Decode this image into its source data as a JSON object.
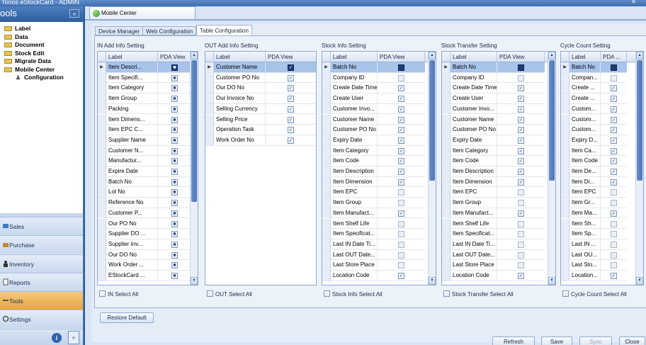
{
  "window": {
    "title": "Tonos eStockCard - ADMIN"
  },
  "leftpane": {
    "header": "ools",
    "tree": [
      {
        "label": "Label"
      },
      {
        "label": "Data"
      },
      {
        "label": "Document"
      },
      {
        "label": "Stock Edit"
      },
      {
        "label": "Migrate Data"
      },
      {
        "label": "Mobile Center"
      }
    ],
    "tree_child": "Configuration",
    "nav": [
      {
        "label": "Sales",
        "icon": "sales-icon"
      },
      {
        "label": "Purchase",
        "icon": "purchase-icon"
      },
      {
        "label": "Inventory",
        "icon": "inventory-icon"
      },
      {
        "label": "Reports",
        "icon": "reports-icon"
      },
      {
        "label": "Tools",
        "icon": "tools-icon",
        "active": true
      },
      {
        "label": "Settings",
        "icon": "settings-icon"
      }
    ],
    "footer_info_icon": "info-icon",
    "footer_more_icon": "chevron-double-down-icon"
  },
  "main": {
    "doc_tab": "Mobile Center",
    "tabs": [
      {
        "label": "Device Manager"
      },
      {
        "label": "Web Configuration"
      },
      {
        "label": "Table Configuration",
        "selected": true
      }
    ],
    "columns": {
      "label": "Label",
      "pda": "PDA View"
    },
    "sections": [
      {
        "title": "IN Add Info Setting",
        "select_all": "IN Select All",
        "rows": [
          {
            "label": "Item Descri...",
            "checked": true
          },
          {
            "label": "Item Specifi...",
            "checked": true
          },
          {
            "label": "Item Category",
            "checked": true
          },
          {
            "label": "Item Group",
            "checked": true
          },
          {
            "label": "Packing",
            "checked": true
          },
          {
            "label": "Item Dimens...",
            "checked": true
          },
          {
            "label": "Item EPC C...",
            "checked": true
          },
          {
            "label": "Supplier Name",
            "checked": true
          },
          {
            "label": "Customer N...",
            "checked": true
          },
          {
            "label": "Manufactur...",
            "checked": true
          },
          {
            "label": "Expire Date",
            "checked": true
          },
          {
            "label": "Batch No",
            "checked": true
          },
          {
            "label": "Lot No",
            "checked": true
          },
          {
            "label": "Reference No",
            "checked": true
          },
          {
            "label": "Customer P...",
            "checked": true
          },
          {
            "label": "Our PO No",
            "checked": true
          },
          {
            "label": "Supplier DO ...",
            "checked": true
          },
          {
            "label": "Supplier Inv...",
            "checked": true
          },
          {
            "label": "Our DO No",
            "checked": true
          },
          {
            "label": "Work Order ...",
            "checked": true
          },
          {
            "label": "EStockCard ...",
            "checked": true
          }
        ]
      },
      {
        "title": "OUT Add Info Setting",
        "select_all": "OUT Select All",
        "rows": [
          {
            "label": "Customer Name",
            "checked": true
          },
          {
            "label": "Customer PO No",
            "checked": true
          },
          {
            "label": "Our DO No",
            "checked": true
          },
          {
            "label": "Our Invoice No",
            "checked": true
          },
          {
            "label": "Selling Currency",
            "checked": true
          },
          {
            "label": "Selling Price",
            "checked": true
          },
          {
            "label": "Operation Task",
            "checked": true
          },
          {
            "label": "Work Order No",
            "checked": true
          }
        ]
      },
      {
        "title": "Stock Info Setting",
        "select_all": "Stock Info Select All",
        "rows": [
          {
            "label": "Batch No",
            "checked": false
          },
          {
            "label": "Company ID",
            "checked": false
          },
          {
            "label": "Create Date Time",
            "checked": true
          },
          {
            "label": "Create User",
            "checked": true
          },
          {
            "label": "Customer Invo...",
            "checked": true
          },
          {
            "label": "Customer Name",
            "checked": true
          },
          {
            "label": "Customer PO No",
            "checked": true
          },
          {
            "label": "Expiry Date",
            "checked": true
          },
          {
            "label": "Item Category",
            "checked": true
          },
          {
            "label": "Item Code",
            "checked": true
          },
          {
            "label": "Item Description",
            "checked": true
          },
          {
            "label": "Item Dimension",
            "checked": true
          },
          {
            "label": "Item EPC",
            "checked": false
          },
          {
            "label": "Item Group",
            "checked": false
          },
          {
            "label": "Item Manufact...",
            "checked": true
          },
          {
            "label": "Item Shelf Life",
            "checked": false
          },
          {
            "label": "Item Specificat...",
            "checked": false
          },
          {
            "label": "Last IN Date Ti...",
            "checked": false
          },
          {
            "label": "Last OUT Date...",
            "checked": false
          },
          {
            "label": "Last Store Place",
            "checked": false
          },
          {
            "label": "Location Code",
            "checked": true
          }
        ]
      },
      {
        "title": "Stock Transfer Setting",
        "select_all": "Stock Transfer Select All",
        "rows": [
          {
            "label": "Batch No",
            "checked": false
          },
          {
            "label": "Company ID",
            "checked": false
          },
          {
            "label": "Create Date Time",
            "checked": true
          },
          {
            "label": "Create User",
            "checked": true
          },
          {
            "label": "Customer Invo...",
            "checked": true
          },
          {
            "label": "Customer Name",
            "checked": true
          },
          {
            "label": "Customer PO No",
            "checked": true
          },
          {
            "label": "Expiry Date",
            "checked": true
          },
          {
            "label": "Item Category",
            "checked": true
          },
          {
            "label": "Item Code",
            "checked": true
          },
          {
            "label": "Item Description",
            "checked": true
          },
          {
            "label": "Item Dimension",
            "checked": true
          },
          {
            "label": "Item EPC",
            "checked": false
          },
          {
            "label": "Item Group",
            "checked": false
          },
          {
            "label": "Item Manufact...",
            "checked": true
          },
          {
            "label": "Item Shelf Life",
            "checked": false
          },
          {
            "label": "Item Specificat...",
            "checked": false
          },
          {
            "label": "Last IN Date Ti...",
            "checked": false
          },
          {
            "label": "Last OUT Date...",
            "checked": false
          },
          {
            "label": "Last Store Place",
            "checked": false
          },
          {
            "label": "Location Code",
            "checked": true
          }
        ]
      },
      {
        "title": "Cycle Count Setting",
        "select_all": "Cycle Count Select All",
        "rows": [
          {
            "label": "Batch No",
            "checked": false
          },
          {
            "label": "Compan...",
            "checked": false
          },
          {
            "label": "Create ...",
            "checked": true
          },
          {
            "label": "Create ...",
            "checked": true
          },
          {
            "label": "Custom...",
            "checked": true
          },
          {
            "label": "Custom...",
            "checked": true
          },
          {
            "label": "Custom...",
            "checked": true
          },
          {
            "label": "Expiry D...",
            "checked": true
          },
          {
            "label": "Item Ca...",
            "checked": true
          },
          {
            "label": "Item Code",
            "checked": true
          },
          {
            "label": "Item De...",
            "checked": true
          },
          {
            "label": "Item Di...",
            "checked": true
          },
          {
            "label": "Item EPC",
            "checked": false
          },
          {
            "label": "Item Gr...",
            "checked": false
          },
          {
            "label": "Item Ma...",
            "checked": true
          },
          {
            "label": "Item Sh...",
            "checked": false
          },
          {
            "label": "Item Sp...",
            "checked": false
          },
          {
            "label": "Last IN ...",
            "checked": false
          },
          {
            "label": "Last OU...",
            "checked": false
          },
          {
            "label": "Last Sto...",
            "checked": false
          },
          {
            "label": "Location...",
            "checked": true
          }
        ]
      }
    ],
    "cycle_pda_header": "PDA ...",
    "restore_default": "Restore Default",
    "buttons": {
      "refresh": "Refresh",
      "save": "Save",
      "sync": "Sync",
      "close": "Close"
    }
  },
  "colors": {
    "accent": "#2c5d9a",
    "active_nav": "#e9a53d",
    "selection": "#a8c4ea"
  }
}
